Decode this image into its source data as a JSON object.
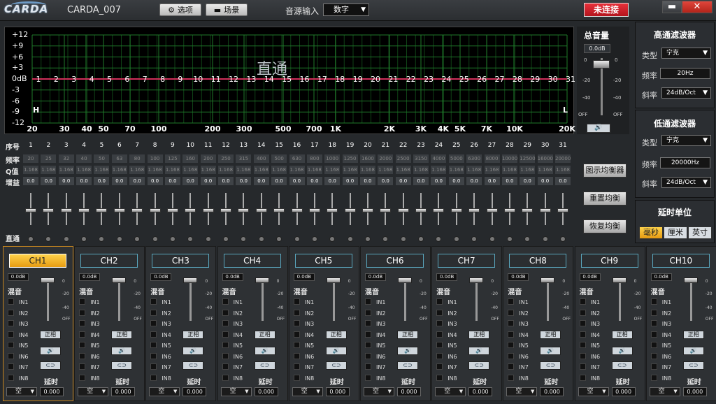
{
  "app": {
    "logo": "CARDA",
    "title": "CARDA_007",
    "options_btn": "选项",
    "scene_btn": "场景",
    "source_label": "音源输入",
    "source_value": "数字",
    "status": "未连接"
  },
  "graph": {
    "title": "直通",
    "y_labels": [
      "+12",
      "+9",
      "+6",
      "+3",
      "0dB",
      "-3",
      "-6",
      "-9",
      "-12"
    ],
    "x_labels": [
      "20",
      "30",
      "40",
      "50",
      "70",
      "100",
      "200",
      "300",
      "500",
      "700",
      "1K",
      "2K",
      "3K",
      "4K",
      "5K",
      "7K",
      "10K",
      "20K"
    ],
    "left_marker": "H",
    "right_marker": "L"
  },
  "master": {
    "title": "总音量",
    "value": "0.0dB",
    "scale": [
      "0",
      "-20",
      "-40",
      "OFF"
    ]
  },
  "bands": {
    "row_labels": {
      "index": "序号",
      "freq": "频率",
      "q": "Q值",
      "gain": "增益",
      "bypass": "直通"
    },
    "numbers": [
      "1",
      "2",
      "3",
      "4",
      "5",
      "6",
      "7",
      "8",
      "9",
      "10",
      "11",
      "12",
      "13",
      "14",
      "15",
      "16",
      "17",
      "18",
      "19",
      "20",
      "21",
      "22",
      "23",
      "24",
      "25",
      "26",
      "27",
      "28",
      "29",
      "30",
      "31"
    ],
    "freqs": [
      "20",
      "25",
      "32",
      "40",
      "50",
      "63",
      "80",
      "100",
      "125",
      "160",
      "200",
      "250",
      "315",
      "400",
      "500",
      "630",
      "800",
      "1000",
      "1250",
      "1600",
      "2000",
      "2500",
      "3150",
      "4000",
      "5000",
      "6300",
      "8000",
      "10000",
      "12500",
      "16000",
      "20000"
    ],
    "q": "1.168",
    "gain": "0.0"
  },
  "buttons": {
    "graphic_eq": "图示均衡器",
    "reset_eq": "重置均衡",
    "restore_eq": "恢复均衡"
  },
  "highpass": {
    "title": "高通滤波器",
    "type_label": "类型",
    "type": "宁克",
    "freq_label": "频率",
    "freq": "20Hz",
    "slope_label": "斜率",
    "slope": "24dB/Oct"
  },
  "lowpass": {
    "title": "低通滤波器",
    "type_label": "类型",
    "type": "宁克",
    "freq_label": "频率",
    "freq": "20000Hz",
    "slope_label": "斜率",
    "slope": "24dB/Oct"
  },
  "delay_unit": {
    "title": "延时单位",
    "options": [
      "毫秒",
      "厘米",
      "英寸"
    ],
    "selected": "毫秒"
  },
  "channels": {
    "names": [
      "CH1",
      "CH2",
      "CH3",
      "CH4",
      "CH5",
      "CH6",
      "CH7",
      "CH8",
      "CH9",
      "CH10"
    ],
    "value": "0.0dB",
    "mix_label": "混音",
    "inputs": [
      "IN1",
      "IN2",
      "IN3",
      "IN4",
      "IN5",
      "IN6",
      "IN7",
      "IN8"
    ],
    "scale": [
      "0",
      "-20",
      "-40",
      "OFF"
    ],
    "phase": "正相",
    "delay_label": "延时",
    "select": "空",
    "delay": "0.000",
    "active": "CH1"
  }
}
